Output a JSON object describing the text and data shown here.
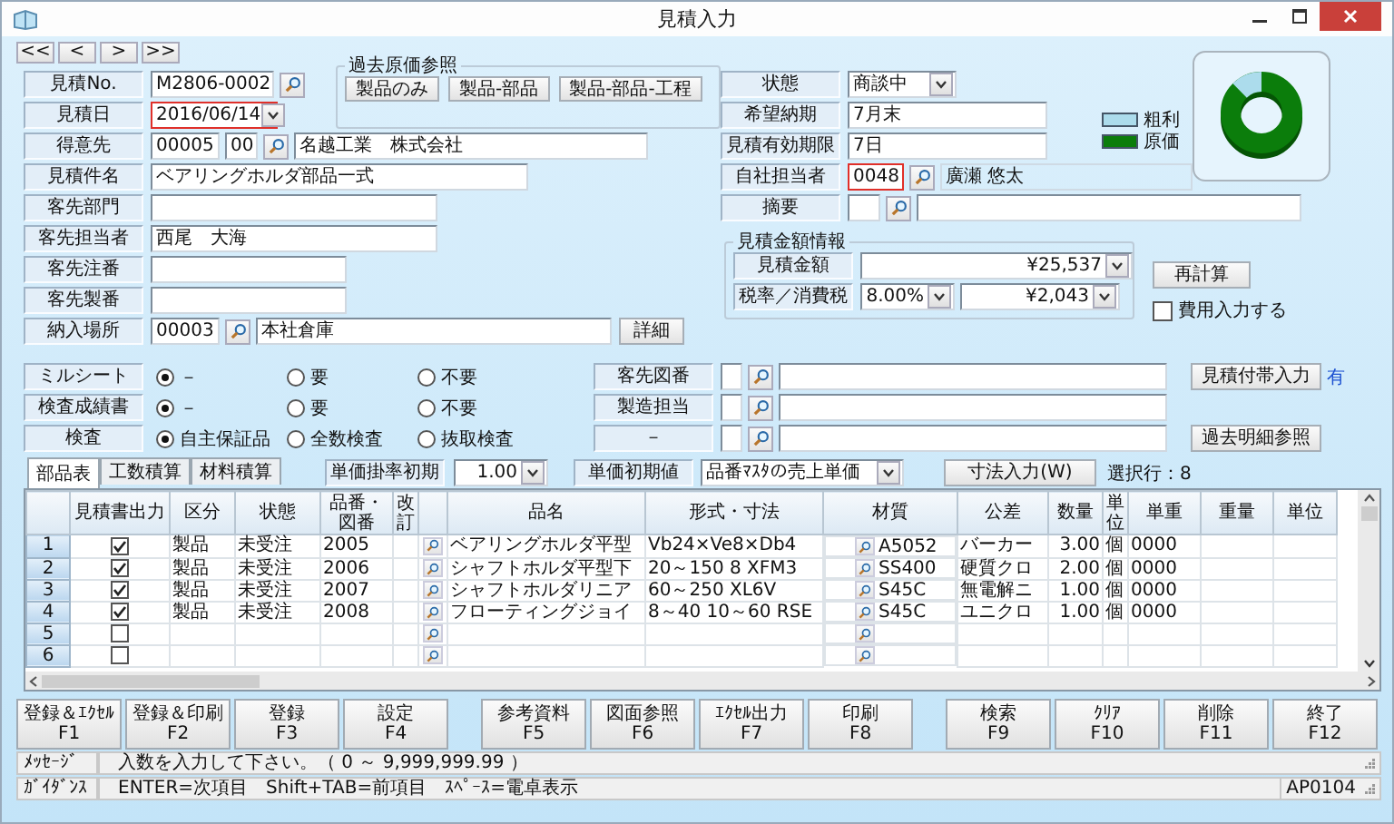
{
  "window": {
    "title": "見積入力"
  },
  "nav_buttons": [
    "<<",
    "<",
    ">",
    ">>"
  ],
  "left_fields": [
    {
      "kind": "lookup",
      "label": "見積No.",
      "value": "M2806-0002",
      "highlighted": false
    },
    {
      "kind": "date",
      "label": "見積日",
      "value": "2016/06/14",
      "highlighted": true
    },
    {
      "kind": "customer",
      "label": "得意先",
      "code": "00005",
      "branch": "00",
      "name": "名越工業　株式会社",
      "highlighted": false
    },
    {
      "kind": "text",
      "label": "見積件名",
      "value": "ベアリングホルダ部品一式",
      "highlighted": false
    },
    {
      "kind": "text",
      "label": "客先部門",
      "highlighted": false
    },
    {
      "kind": "text",
      "label": "客先担当者",
      "value": "西尾　大海",
      "highlighted": false
    },
    {
      "kind": "text",
      "label": "客先注番",
      "highlighted": false
    },
    {
      "kind": "text",
      "label": "客先製番",
      "highlighted": false
    },
    {
      "kind": "place",
      "label": "納入場所",
      "code": "00003",
      "name": "本社倉庫",
      "button": "詳細",
      "highlighted": false
    }
  ],
  "past_cost": {
    "title": "過去原価参照",
    "buttons": [
      "製品のみ",
      "製品-部品",
      "製品-部品-工程"
    ]
  },
  "right_fields": [
    {
      "kind": "select",
      "label": "状態",
      "value": "商談中",
      "highlighted": false
    },
    {
      "kind": "text",
      "label": "希望納期",
      "value": "7月末",
      "highlighted": false
    },
    {
      "kind": "text",
      "label": "見積有効期限",
      "value": "7日",
      "highlighted": false
    },
    {
      "kind": "staff",
      "label": "自社担当者",
      "code": "0048",
      "name": "廣瀬 悠太",
      "highlighted": true
    },
    {
      "kind": "remark",
      "label": "摘要",
      "highlighted": false
    }
  ],
  "legend": [
    {
      "label": "粗利",
      "color": "#acdcec"
    },
    {
      "label": "原価",
      "color": "#0b7d0b"
    }
  ],
  "amount_info": {
    "title": "見積金額情報",
    "amount_label": "見積金額",
    "amount": "¥25,537",
    "tax_label": "税率／消費税",
    "tax_rate": "8.00%",
    "tax": "¥2,043"
  },
  "recalc_button": "再計算",
  "expense_input": {
    "label": "費用入力する",
    "checked": false
  },
  "options": [
    {
      "label": "ミルシート",
      "choices": [
        {
          "label": "－",
          "selected": true
        },
        {
          "label": "要",
          "selected": false
        },
        {
          "label": "不要",
          "selected": false
        }
      ]
    },
    {
      "label": "検査成績書",
      "choices": [
        {
          "label": "－",
          "selected": true
        },
        {
          "label": "要",
          "selected": false
        },
        {
          "label": "不要",
          "selected": false
        }
      ]
    },
    {
      "label": "検査",
      "choices": [
        {
          "label": "自主保証品",
          "selected": true
        },
        {
          "label": "全数検査",
          "selected": false
        },
        {
          "label": "抜取検査",
          "selected": false
        }
      ]
    }
  ],
  "references": [
    {
      "label": "客先図番",
      "button": "見積付帯入力",
      "badge": "有"
    },
    {
      "label": "製造担当"
    },
    {
      "label": "－",
      "button": "過去明細参照"
    }
  ],
  "tabs": [
    {
      "label": "部品表",
      "selected": true
    },
    {
      "label": "工数積算",
      "selected": false
    },
    {
      "label": "材料積算",
      "selected": false
    }
  ],
  "defaults": {
    "rate_label": "単価掛率初期",
    "rate": "1.00",
    "price_label": "単価初期値",
    "price": "品番ﾏｽﾀの売上単価",
    "dimension_button": "寸法入力(W)",
    "selected_rows": "選択行：8"
  },
  "table": {
    "columns": [
      "見積書出力",
      "区分",
      "状態",
      "品番・図番",
      "改訂",
      "品名",
      "形式・寸法",
      "材質",
      "公差",
      "数量",
      "単位",
      "単重",
      "重量",
      "単位"
    ],
    "rows": [
      {
        "no": "1",
        "output": true,
        "category": "製品",
        "status": "未受注",
        "part_no": "2005",
        "name": "ベアリングホルダ平型",
        "spec": "Vb24×Ve8×Db4",
        "material": "A5052",
        "tolerance": "バーカー",
        "qty": "3.00",
        "unit": "個",
        "unit_weight": "0000"
      },
      {
        "no": "2",
        "output": true,
        "category": "製品",
        "status": "未受注",
        "part_no": "2006",
        "name": "シャフトホルダ平型下",
        "spec": "20～150 8 XFM3",
        "material": "SS400",
        "tolerance": "硬質クロ",
        "qty": "2.00",
        "unit": "個",
        "unit_weight": "0000"
      },
      {
        "no": "3",
        "output": true,
        "category": "製品",
        "status": "未受注",
        "part_no": "2007",
        "name": "シャフトホルダリニア",
        "spec": "60～250 XL6V",
        "material": "S45C",
        "tolerance": "無電解ニ",
        "qty": "1.00",
        "unit": "個",
        "unit_weight": "0000"
      },
      {
        "no": "4",
        "output": true,
        "category": "製品",
        "status": "未受注",
        "part_no": "2008",
        "name": "フローティングジョイ",
        "spec": "8～40 10～60 RSE",
        "material": "S45C",
        "tolerance": "ユニクロ",
        "qty": "1.00",
        "unit": "個",
        "unit_weight": "0000"
      },
      {
        "no": "5",
        "output": false
      },
      {
        "no": "6",
        "output": false
      }
    ]
  },
  "function_keys": [
    [
      {
        "label": "登録＆ｴｸｾﾙ",
        "key": "F1"
      },
      {
        "label": "登録＆印刷",
        "key": "F2"
      },
      {
        "label": "登録",
        "key": "F3"
      },
      {
        "label": "設定",
        "key": "F4"
      }
    ],
    [
      {
        "label": "参考資料",
        "key": "F5"
      },
      {
        "label": "図面参照",
        "key": "F6"
      },
      {
        "label": "ｴｸｾﾙ出力",
        "key": "F7"
      },
      {
        "label": "印刷",
        "key": "F8"
      }
    ],
    [
      {
        "label": "検索",
        "key": "F9"
      },
      {
        "label": "ｸﾘｱ",
        "key": "F10"
      },
      {
        "label": "削除",
        "key": "F11"
      },
      {
        "label": "終了",
        "key": "F12"
      }
    ]
  ],
  "status_bar": {
    "message_label": "ﾒｯｾｰｼﾞ",
    "message": "入数を入力して下さい。（ 0 ～ 9,999,999.99 ）",
    "guidance_label": "ｶﾞｲﾀﾞﾝｽ",
    "guidance": "ENTER=次項目　Shift+TAB=前項目　ｽﾍﾟｰｽ=電卓表示",
    "screen_id": "AP0104"
  }
}
